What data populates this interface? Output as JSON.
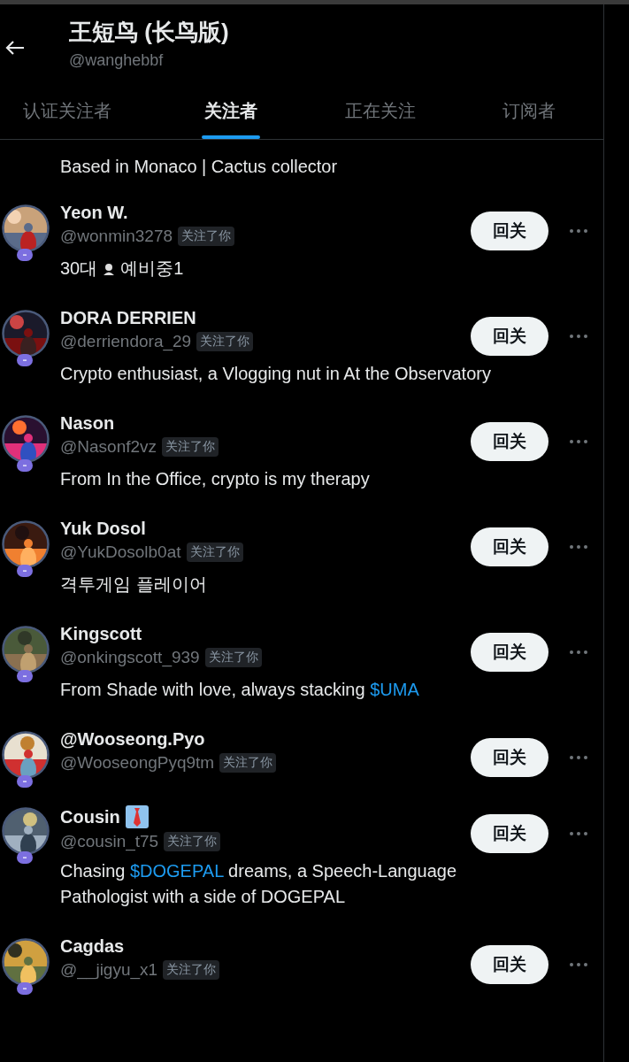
{
  "header": {
    "title": "王短鸟 (长鸟版)",
    "handle": "@wanghebbf"
  },
  "tabs": [
    {
      "label": "认证关注者",
      "selected": false
    },
    {
      "label": "关注者",
      "selected": true
    },
    {
      "label": "正在关注",
      "selected": false
    },
    {
      "label": "订阅者",
      "selected": false
    }
  ],
  "partial_row": {
    "bio": [
      {
        "kind": "text",
        "text": "Based in Monaco | Cactus collector"
      }
    ]
  },
  "users": [
    {
      "name": "Yeon W.",
      "handle": "@wonmin3278",
      "follows_you": "关注了你",
      "bio": [
        {
          "kind": "text",
          "text": "30대"
        },
        {
          "kind": "emoji"
        },
        {
          "kind": "text",
          "text": "예비중1"
        }
      ],
      "button": "回关",
      "avatar": {
        "kind": "picture"
      }
    },
    {
      "name": "DORA DERRIEN",
      "handle": "@derriendora_29",
      "follows_you": "关注了你",
      "bio": [
        {
          "kind": "text",
          "text": "Crypto enthusiast, a Vlogging nut in At the Observatory"
        }
      ],
      "button": "回关",
      "avatar": {
        "kind": "picture"
      }
    },
    {
      "name": "Nason",
      "handle": "@Nasonf2vz",
      "follows_you": "关注了你",
      "bio": [
        {
          "kind": "text",
          "text": "From In the Office, crypto is my therapy"
        }
      ],
      "button": "回关",
      "avatar": {
        "kind": "picture"
      }
    },
    {
      "name": "Yuk Dosol",
      "handle": "@YukDosolb0at",
      "follows_you": "关注了你",
      "bio": [
        {
          "kind": "text",
          "text": "격투게임 플레이어"
        }
      ],
      "button": "回关",
      "avatar": {
        "kind": "picture"
      }
    },
    {
      "name": "Kingscott",
      "handle": "@onkingscott_939",
      "follows_you": "关注了你",
      "bio": [
        {
          "kind": "text",
          "text": "From Shade with love, always stacking "
        },
        {
          "kind": "link",
          "text": "$UMA"
        }
      ],
      "button": "回关",
      "avatar": {
        "kind": "picture"
      }
    },
    {
      "name": "@Wooseong.Pyo",
      "handle": "@WooseongPyq9tm",
      "follows_you": "关注了你",
      "button": "回关",
      "avatar": {
        "kind": "picture"
      }
    },
    {
      "name": "Cousin",
      "name_icon": true,
      "handle": "@cousin_t75",
      "follows_you": "关注了你",
      "bio": [
        {
          "kind": "text",
          "text": "Chasing "
        },
        {
          "kind": "link",
          "text": "$DOGEPAL"
        },
        {
          "kind": "text",
          "text": " dreams, a Speech-Language Pathologist with a side of DOGEPAL"
        }
      ],
      "button": "回关",
      "avatar": {
        "kind": "picture"
      }
    },
    {
      "name": "Cagdas",
      "handle": "@__jigyu_x1",
      "follows_you": "关注了你",
      "button": "回关",
      "avatar": {
        "kind": "picture"
      }
    }
  ]
}
